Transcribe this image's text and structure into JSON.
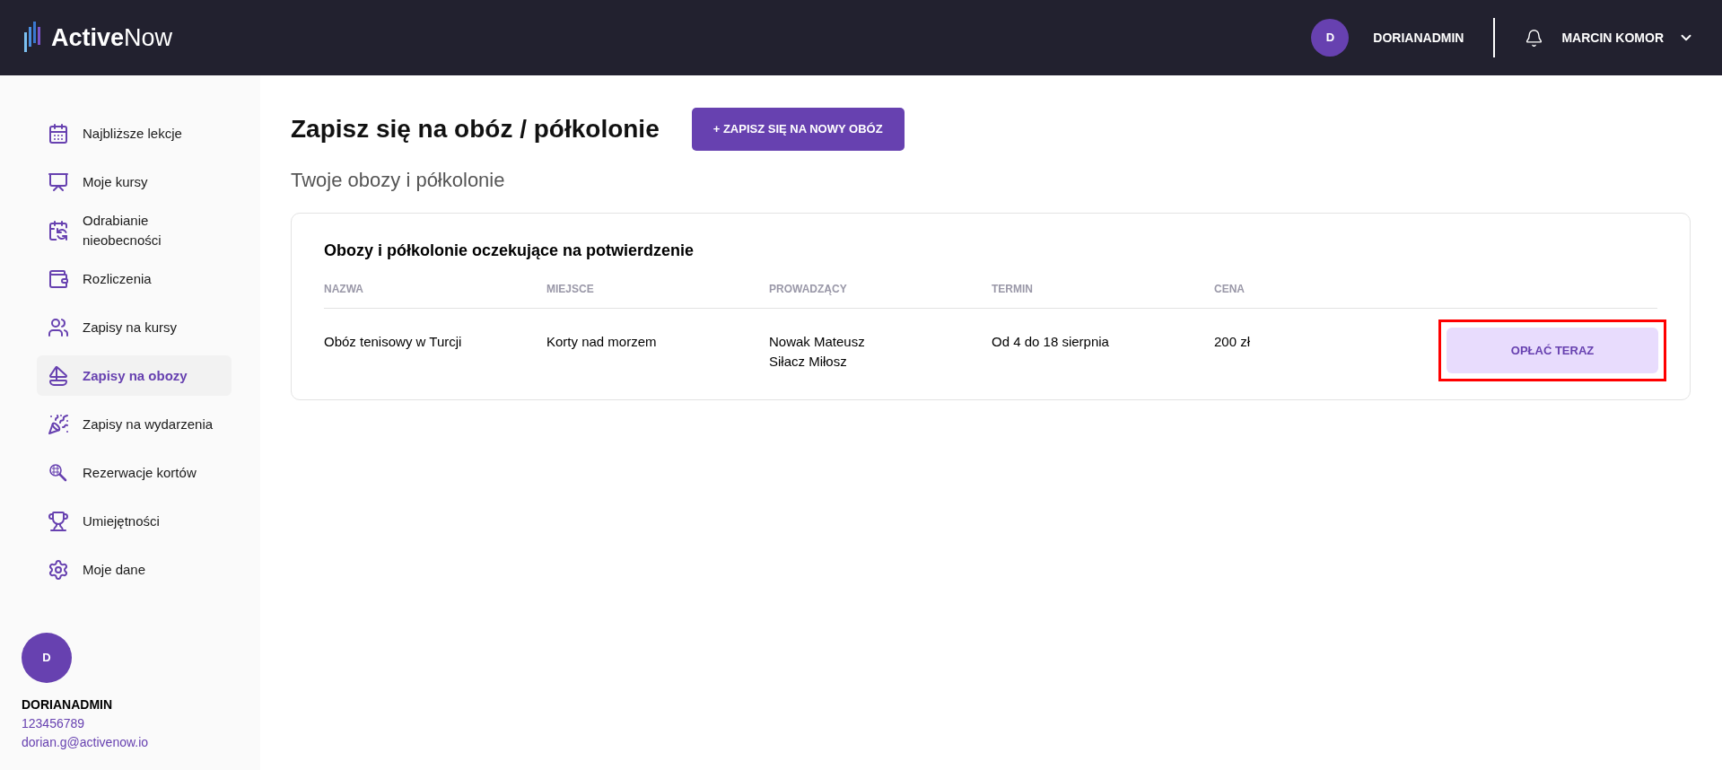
{
  "header": {
    "logo": {
      "bold": "Active",
      "light": "Now"
    },
    "account": {
      "avatar": "D",
      "name": "DORIANADMIN"
    },
    "user": {
      "name": "MARCIN KOMOR"
    }
  },
  "sidebar": {
    "items": [
      {
        "label": "Najbliższe lekcje",
        "selected": false
      },
      {
        "label": "Moje kursy",
        "selected": false
      },
      {
        "label": "Odrabianie nieobecności",
        "selected": false
      },
      {
        "label": "Rozliczenia",
        "selected": false
      },
      {
        "label": "Zapisy na kursy",
        "selected": false
      },
      {
        "label": "Zapisy na obozy",
        "selected": true
      },
      {
        "label": "Zapisy na wydarzenia",
        "selected": false
      },
      {
        "label": "Rezerwacje kortów",
        "selected": false
      },
      {
        "label": "Umiejętności",
        "selected": false
      },
      {
        "label": "Moje dane",
        "selected": false
      }
    ],
    "profile": {
      "avatar": "D",
      "name": "DORIANADMIN",
      "phone": "123456789",
      "email": "dorian.g@activenow.io"
    }
  },
  "page": {
    "title": "Zapisz się na obóz / półkolonie",
    "new_button": "+ ZAPISZ SIĘ NA NOWY OBÓZ",
    "subtitle": "Twoje obozy i półkolonie"
  },
  "table": {
    "title": "Obozy i półkolonie oczekujące na potwierdzenie",
    "columns": [
      "NAZWA",
      "MIEJSCE",
      "PROWADZĄCY",
      "TERMIN",
      "CENA"
    ],
    "rows": [
      {
        "cells": [
          "Obóz tenisowy w Turcji",
          "Korty nad morzem",
          [
            "Nowak Mateusz",
            "Siłacz Miłosz"
          ],
          "Od 4 do 18 sierpnia",
          "200 zł"
        ],
        "action": "OPŁAĆ TERAZ",
        "highlighted": true
      }
    ]
  }
}
